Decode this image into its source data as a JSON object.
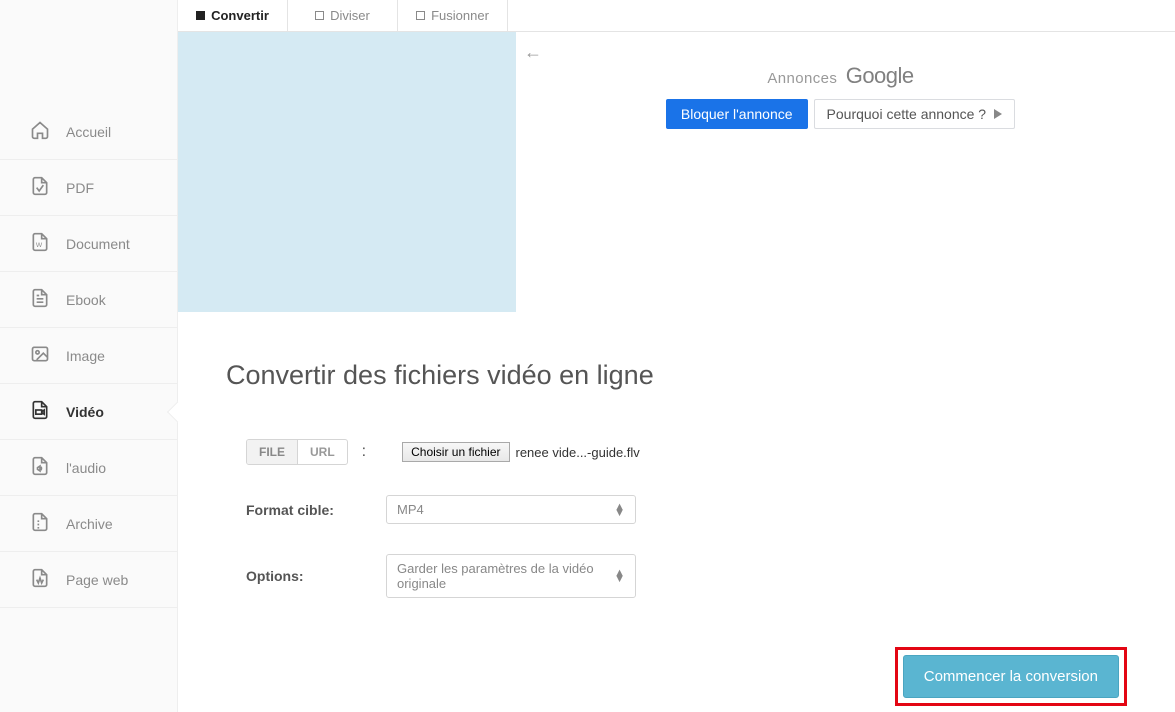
{
  "sidebar": {
    "items": [
      {
        "label": "Accueil",
        "icon": "home"
      },
      {
        "label": "PDF",
        "icon": "pdf"
      },
      {
        "label": "Document",
        "icon": "doc"
      },
      {
        "label": "Ebook",
        "icon": "ebook"
      },
      {
        "label": "Image",
        "icon": "image"
      },
      {
        "label": "Vidéo",
        "icon": "video",
        "active": true
      },
      {
        "label": "l'audio",
        "icon": "audio"
      },
      {
        "label": "Archive",
        "icon": "archive"
      },
      {
        "label": "Page web",
        "icon": "web"
      }
    ]
  },
  "tabs": [
    {
      "label": "Convertir",
      "active": true
    },
    {
      "label": "Diviser"
    },
    {
      "label": "Fusionner"
    }
  ],
  "ads": {
    "annonces": "Annonces",
    "google": "Google",
    "block": "Bloquer l'annonce",
    "why": "Pourquoi cette annonce ?"
  },
  "page": {
    "title": "Convertir des fichiers vidéo en ligne",
    "source_tabs": {
      "file": "FILE",
      "url": "URL"
    },
    "choose_file": "Choisir un fichier",
    "chosen_file": "renee vide...-guide.flv",
    "format_label": "Format cible:",
    "format_value": "MP4",
    "options_label": "Options:",
    "options_value": "Garder les paramètres de la vidéo originale",
    "submit": "Commencer la conversion"
  }
}
